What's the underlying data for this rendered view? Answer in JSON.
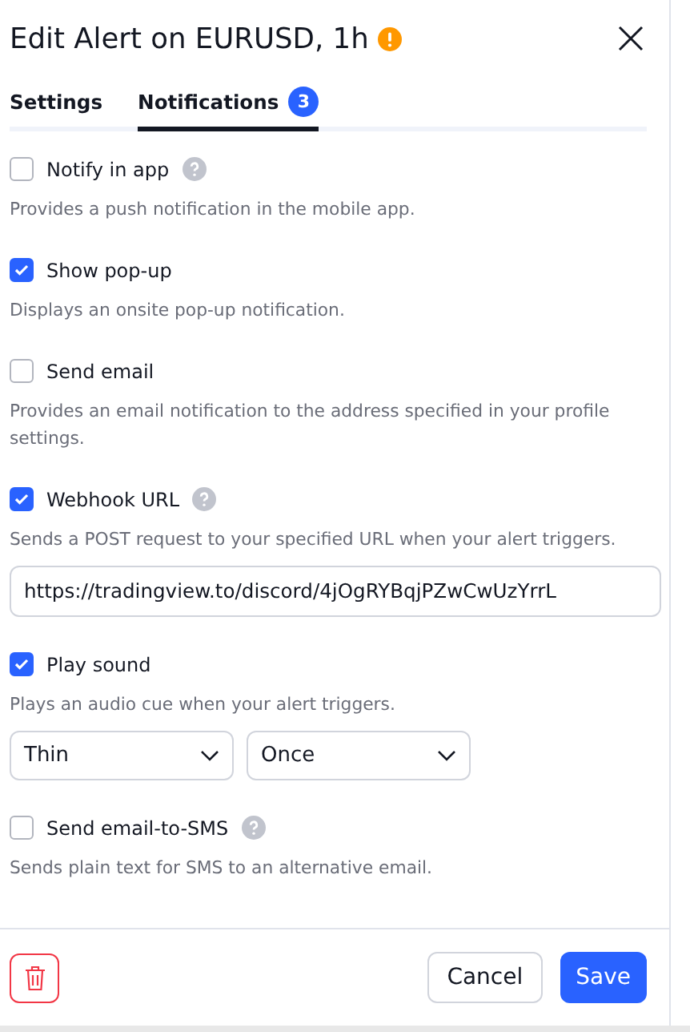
{
  "dialog": {
    "title": "Edit Alert on EURUSD, 1h",
    "warning": true
  },
  "tabs": [
    {
      "label": "Settings",
      "selected": false
    },
    {
      "label": "Notifications",
      "selected": true,
      "badge": "3"
    }
  ],
  "options": [
    {
      "kind": "plain",
      "label": "Notify in app",
      "checked": false,
      "help": true,
      "description": "Provides a push notification in the mobile app."
    },
    {
      "kind": "plain",
      "label": "Show pop-up",
      "checked": true,
      "help": false,
      "description": "Displays an onsite pop-up notification."
    },
    {
      "kind": "plain",
      "label": "Send email",
      "checked": false,
      "help": false,
      "description": "Provides an email notification to the address specified in your profile settings."
    },
    {
      "kind": "url",
      "label": "Webhook URL",
      "checked": true,
      "help": true,
      "description": "Sends a POST request to your specified URL when your alert triggers.",
      "value": "https://tradingview.to/discord/4jOgRYBqjPZwCwUzYrrL"
    },
    {
      "kind": "sound",
      "label": "Play sound",
      "checked": true,
      "help": false,
      "description": "Plays an audio cue when your alert triggers.",
      "selects": [
        "Thin",
        "Once"
      ]
    },
    {
      "kind": "plain",
      "label": "Send email-to-SMS",
      "checked": false,
      "help": true,
      "description": "Sends plain text for SMS to an alternative email."
    }
  ],
  "footer": {
    "cancel": "Cancel",
    "save": "Save"
  }
}
